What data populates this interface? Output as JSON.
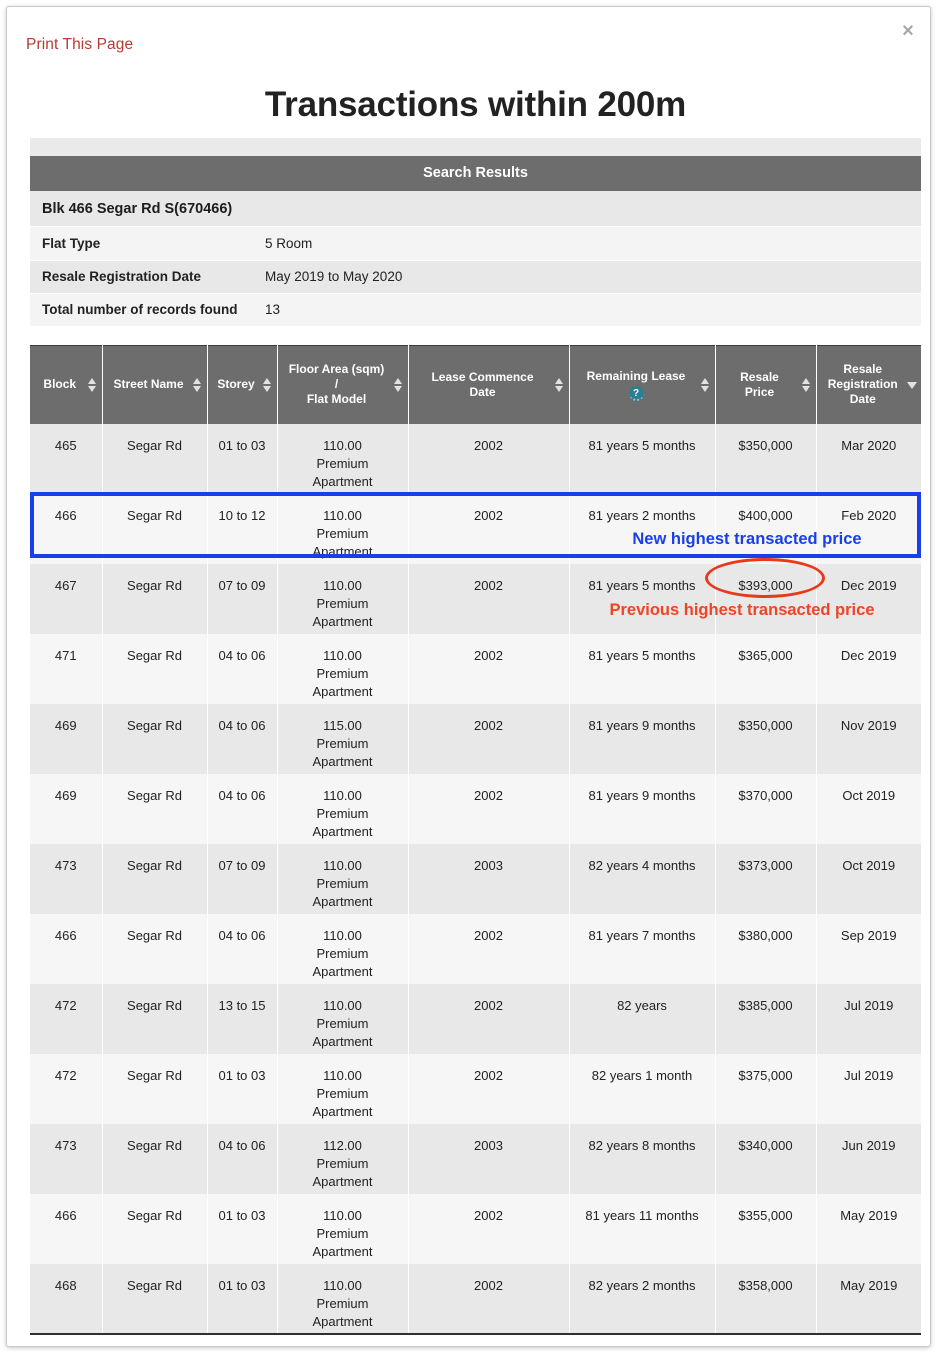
{
  "modal": {
    "close_icon": "close-icon",
    "print_link": "Print This Page",
    "title": "Transactions within 200m"
  },
  "search_results": {
    "bar_label": "Search Results",
    "address": "Blk 466 Segar Rd S(670466)",
    "info_rows": [
      {
        "label": "Flat Type",
        "value": "5 Room"
      },
      {
        "label": "Resale Registration Date",
        "value": "May 2019 to May 2020"
      },
      {
        "label": "Total number of records found",
        "value": "13"
      }
    ]
  },
  "table": {
    "columns": [
      {
        "label": "Block",
        "sort": "both"
      },
      {
        "label": "Street Name",
        "sort": "both"
      },
      {
        "label": "Storey",
        "sort": "both"
      },
      {
        "label": "Floor Area (sqm) / Flat Model",
        "line1": "Floor Area (sqm)",
        "line2": "/",
        "line3": "Flat Model",
        "sort": "both"
      },
      {
        "label": "Lease Commence Date",
        "line1": "Lease Commence",
        "line2": "Date",
        "sort": "both"
      },
      {
        "label": "Remaining Lease",
        "line1": "Remaining Lease",
        "help_icon": "help-icon",
        "help_text": "?",
        "sort": "both"
      },
      {
        "label": "Resale Price",
        "line1": "Resale",
        "line2": "Price",
        "sort": "both"
      },
      {
        "label": "Resale Registration Date",
        "line1": "Resale",
        "line2": "Registration",
        "line3": "Date",
        "sort": "desc"
      }
    ],
    "rows": [
      {
        "block": "465",
        "street": "Segar Rd",
        "storey": "01 to 03",
        "floor_area": "110.00",
        "flat_model": "Premium Apartment",
        "lease_commence": "2002",
        "remaining_lease": "81 years 5 months",
        "price": "$350,000",
        "reg_date": "Mar 2020"
      },
      {
        "block": "466",
        "street": "Segar Rd",
        "storey": "10 to 12",
        "floor_area": "110.00",
        "flat_model": "Premium Apartment",
        "lease_commence": "2002",
        "remaining_lease": "81 years 2 months",
        "price": "$400,000",
        "reg_date": "Feb 2020"
      },
      {
        "block": "467",
        "street": "Segar Rd",
        "storey": "07 to 09",
        "floor_area": "110.00",
        "flat_model": "Premium Apartment",
        "lease_commence": "2002",
        "remaining_lease": "81 years 5 months",
        "price": "$393,000",
        "reg_date": "Dec 2019"
      },
      {
        "block": "471",
        "street": "Segar Rd",
        "storey": "04 to 06",
        "floor_area": "110.00",
        "flat_model": "Premium Apartment",
        "lease_commence": "2002",
        "remaining_lease": "81 years 5 months",
        "price": "$365,000",
        "reg_date": "Dec 2019"
      },
      {
        "block": "469",
        "street": "Segar Rd",
        "storey": "04 to 06",
        "floor_area": "115.00",
        "flat_model": "Premium Apartment",
        "lease_commence": "2002",
        "remaining_lease": "81 years 9 months",
        "price": "$350,000",
        "reg_date": "Nov 2019"
      },
      {
        "block": "469",
        "street": "Segar Rd",
        "storey": "04 to 06",
        "floor_area": "110.00",
        "flat_model": "Premium Apartment",
        "lease_commence": "2002",
        "remaining_lease": "81 years 9 months",
        "price": "$370,000",
        "reg_date": "Oct 2019"
      },
      {
        "block": "473",
        "street": "Segar Rd",
        "storey": "07 to 09",
        "floor_area": "110.00",
        "flat_model": "Premium Apartment",
        "lease_commence": "2003",
        "remaining_lease": "82 years 4 months",
        "price": "$373,000",
        "reg_date": "Oct 2019"
      },
      {
        "block": "466",
        "street": "Segar Rd",
        "storey": "04 to 06",
        "floor_area": "110.00",
        "flat_model": "Premium Apartment",
        "lease_commence": "2002",
        "remaining_lease": "81 years 7 months",
        "price": "$380,000",
        "reg_date": "Sep 2019"
      },
      {
        "block": "472",
        "street": "Segar Rd",
        "storey": "13 to 15",
        "floor_area": "110.00",
        "flat_model": "Premium Apartment",
        "lease_commence": "2002",
        "remaining_lease": "82 years",
        "price": "$385,000",
        "reg_date": "Jul 2019"
      },
      {
        "block": "472",
        "street": "Segar Rd",
        "storey": "01 to 03",
        "floor_area": "110.00",
        "flat_model": "Premium Apartment",
        "lease_commence": "2002",
        "remaining_lease": "82 years 1 month",
        "price": "$375,000",
        "reg_date": "Jul 2019"
      },
      {
        "block": "473",
        "street": "Segar Rd",
        "storey": "04 to 06",
        "floor_area": "112.00",
        "flat_model": "Premium Apartment",
        "lease_commence": "2003",
        "remaining_lease": "82 years 8 months",
        "price": "$340,000",
        "reg_date": "Jun 2019"
      },
      {
        "block": "466",
        "street": "Segar Rd",
        "storey": "01 to 03",
        "floor_area": "110.00",
        "flat_model": "Premium Apartment",
        "lease_commence": "2002",
        "remaining_lease": "81 years 11 months",
        "price": "$355,000",
        "reg_date": "May 2019"
      },
      {
        "block": "468",
        "street": "Segar Rd",
        "storey": "01 to 03",
        "floor_area": "110.00",
        "flat_model": "Premium Apartment",
        "lease_commence": "2002",
        "remaining_lease": "82 years 2 months",
        "price": "$358,000",
        "reg_date": "May 2019"
      }
    ]
  },
  "annotations": {
    "new_highest": "New highest transacted price",
    "previous_highest": "Previous highest transacted price",
    "highlight_color": "#1a3ee8",
    "circle_color": "#e8391b"
  }
}
